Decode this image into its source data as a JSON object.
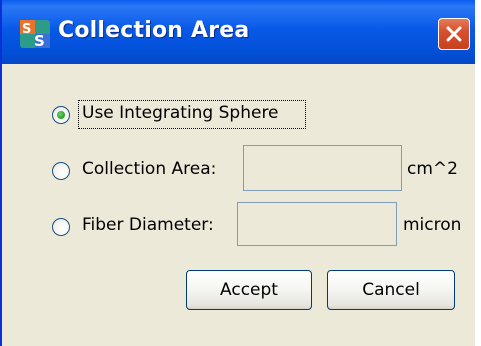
{
  "window": {
    "title": "Collection Area",
    "app_icon": "ss-app-icon",
    "close_icon": "close-icon"
  },
  "options": [
    {
      "label": "Use Integrating Sphere",
      "selected": true
    },
    {
      "label": "Collection Area:",
      "selected": false,
      "input_value": "",
      "unit": "cm^2"
    },
    {
      "label": "Fiber Diameter:",
      "selected": false,
      "input_value": "",
      "unit": "micron"
    }
  ],
  "buttons": {
    "accept": "Accept",
    "cancel": "Cancel"
  },
  "colors": {
    "titlebar": "#0859e8",
    "window_bg": "#ece9d8",
    "close": "#d8512e",
    "radio_selected": "#21a121"
  }
}
